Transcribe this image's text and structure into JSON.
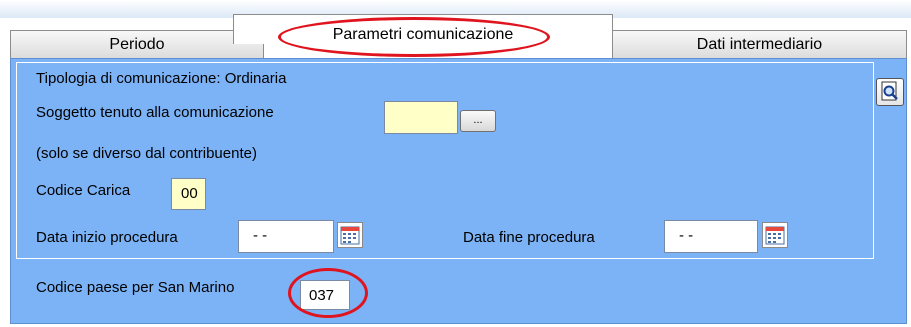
{
  "tabs": {
    "periodo": "Periodo",
    "parametri": "Parametri comunicazione",
    "dati": "Dati intermediario"
  },
  "form": {
    "tipologia": "Tipologia di comunicazione: Ordinaria",
    "soggetto_label": "Soggetto tenuto alla comunicazione",
    "soggetto_value": "",
    "browse_button": "...",
    "soggetto_note": "(solo se diverso dal contribuente)",
    "codice_carica_label": "Codice Carica",
    "codice_carica_value": "00",
    "data_inizio_label": "Data inizio procedura",
    "data_inizio_value": "- -",
    "data_fine_label": "Data fine procedura",
    "data_fine_value": "- -",
    "codice_paese_label": "Codice paese per San Marino",
    "codice_paese_value": "037"
  },
  "icons": {
    "preview": "magnifier-page-icon",
    "calendar": "calendar-icon"
  },
  "colors": {
    "panel": "#7bb3f6",
    "highlight_oval": "#e0141e",
    "yellow_field": "#ffffc8"
  }
}
